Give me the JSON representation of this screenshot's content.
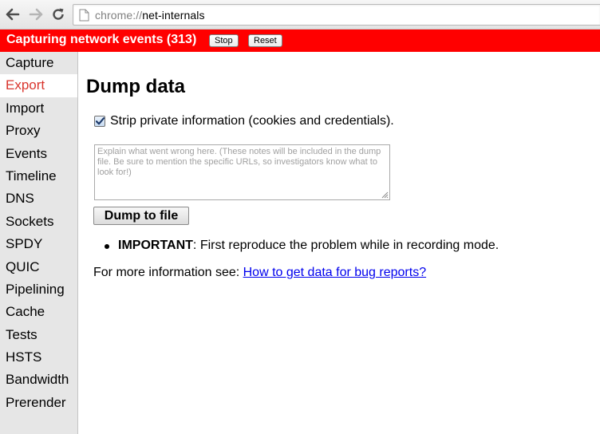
{
  "browser": {
    "url_scheme": "chrome://",
    "url_host": "net-internals"
  },
  "status": {
    "text": "Capturing network events (313)",
    "stop_label": "Stop",
    "reset_label": "Reset"
  },
  "sidebar": {
    "items": [
      {
        "label": "Capture"
      },
      {
        "label": "Export"
      },
      {
        "label": "Import"
      },
      {
        "label": "Proxy"
      },
      {
        "label": "Events"
      },
      {
        "label": "Timeline"
      },
      {
        "label": "DNS"
      },
      {
        "label": "Sockets"
      },
      {
        "label": "SPDY"
      },
      {
        "label": "QUIC"
      },
      {
        "label": "Pipelining"
      },
      {
        "label": "Cache"
      },
      {
        "label": "Tests"
      },
      {
        "label": "HSTS"
      },
      {
        "label": "Bandwidth"
      },
      {
        "label": "Prerender"
      }
    ],
    "selected": "Export"
  },
  "main": {
    "title": "Dump data",
    "strip_private_label": "Strip private information (cookies and credentials).",
    "strip_private_checked": true,
    "notes_placeholder": "Explain what went wrong here. (These notes will be included in the dump file. Be sure to mention the specific URLs, so investigators know what to look for!)",
    "dump_button_label": "Dump to file",
    "important_bold": "IMPORTANT",
    "important_text": ": First reproduce the problem while in recording mode.",
    "more_info_text": "For more information see: ",
    "more_info_link": "How to get data for bug reports?"
  },
  "colors": {
    "status_bar": "#ff0000",
    "selected_item": "#d9362e",
    "sidebar_bg": "#e6e6e6",
    "link": "#0000ee"
  }
}
